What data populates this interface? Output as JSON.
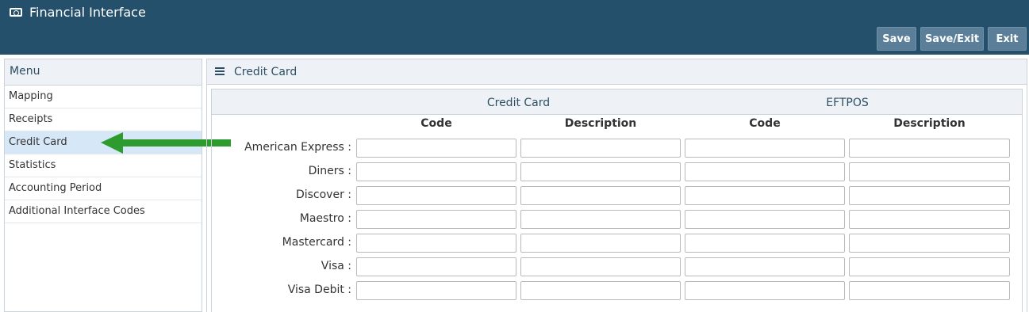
{
  "app": {
    "title": "Financial Interface",
    "icon": "money-icon"
  },
  "toolbar": {
    "save": "Save",
    "save_exit": "Save/Exit",
    "exit": "Exit"
  },
  "sidebar": {
    "header": "Menu",
    "items": [
      {
        "label": "Mapping"
      },
      {
        "label": "Receipts"
      },
      {
        "label": "Credit Card",
        "active": true
      },
      {
        "label": "Statistics"
      },
      {
        "label": "Accounting Period"
      },
      {
        "label": "Additional Interface Codes"
      }
    ]
  },
  "annotation": {
    "arrow_color": "#2e9b2e"
  },
  "main": {
    "title": "Credit Card",
    "groups": {
      "credit_card": "Credit Card",
      "eftpos": "EFTPOS"
    },
    "columns": {
      "cc_code": "Code",
      "cc_description": "Description",
      "ef_code": "Code",
      "ef_description": "Description"
    },
    "rows": [
      {
        "label": "American Express :",
        "cc_code": "",
        "cc_description": "",
        "ef_code": "",
        "ef_description": ""
      },
      {
        "label": "Diners :",
        "cc_code": "",
        "cc_description": "",
        "ef_code": "",
        "ef_description": ""
      },
      {
        "label": "Discover :",
        "cc_code": "",
        "cc_description": "",
        "ef_code": "",
        "ef_description": ""
      },
      {
        "label": "Maestro :",
        "cc_code": "",
        "cc_description": "",
        "ef_code": "",
        "ef_description": ""
      },
      {
        "label": "Mastercard :",
        "cc_code": "",
        "cc_description": "",
        "ef_code": "",
        "ef_description": ""
      },
      {
        "label": "Visa :",
        "cc_code": "",
        "cc_description": "",
        "ef_code": "",
        "ef_description": ""
      },
      {
        "label": "Visa Debit :",
        "cc_code": "",
        "cc_description": "",
        "ef_code": "",
        "ef_description": ""
      }
    ]
  },
  "colors": {
    "header_bg": "#24506c",
    "button_bg": "#5b7f98",
    "active_item_bg": "#d6e7f7"
  }
}
